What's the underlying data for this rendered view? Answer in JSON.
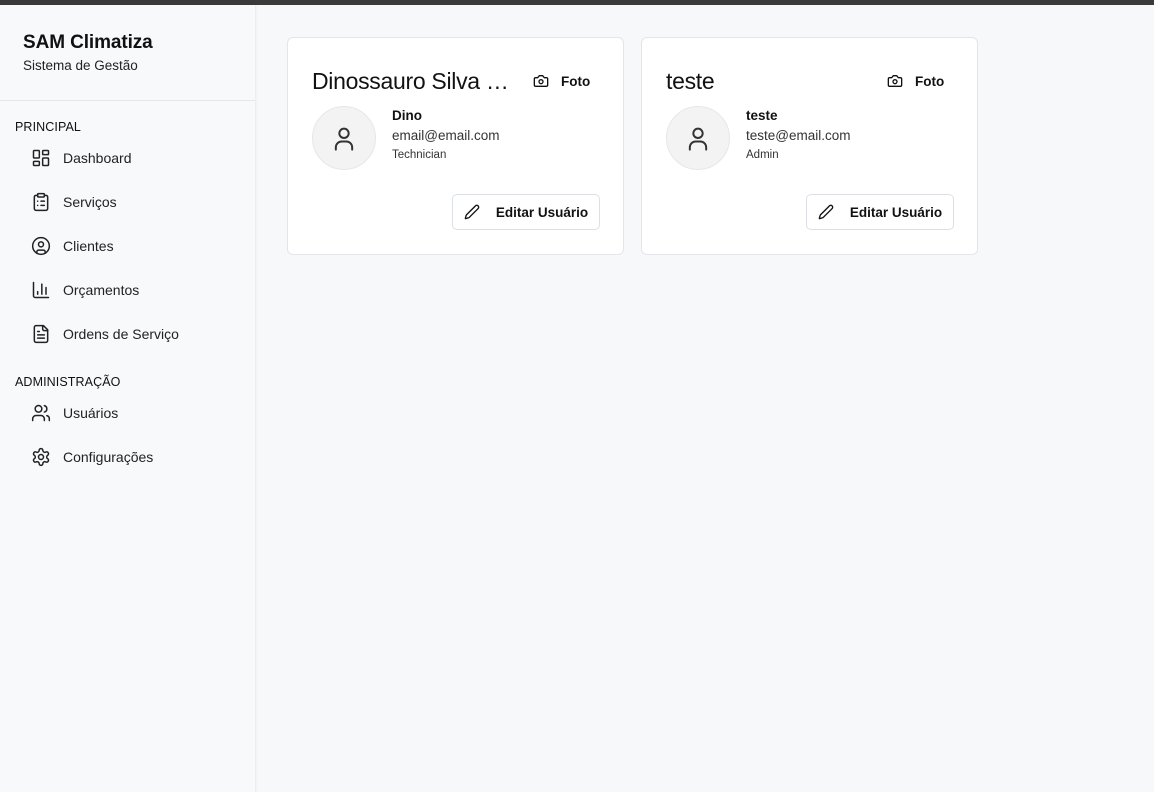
{
  "brand": {
    "title": "SAM Climatiza",
    "subtitle": "Sistema de Gestão"
  },
  "sidebar": {
    "sections": [
      {
        "label": "PRINCIPAL",
        "items": [
          {
            "label": "Dashboard",
            "icon": "layout-dashboard-icon"
          },
          {
            "label": "Serviços",
            "icon": "clipboard-list-icon"
          },
          {
            "label": "Clientes",
            "icon": "user-circle-icon"
          },
          {
            "label": "Orçamentos",
            "icon": "bar-chart-icon"
          },
          {
            "label": "Ordens de Serviço",
            "icon": "file-text-icon"
          }
        ]
      },
      {
        "label": "ADMINISTRAÇÃO",
        "items": [
          {
            "label": "Usuários",
            "icon": "users-icon"
          },
          {
            "label": "Configurações",
            "icon": "settings-icon"
          }
        ]
      }
    ]
  },
  "users": [
    {
      "title": "Dinossauro Silva Santos",
      "name": "Dino",
      "email": "email@email.com",
      "role": "Technician",
      "photo_label": "Foto",
      "edit_label": "Editar Usuário"
    },
    {
      "title": "teste",
      "name": "teste",
      "email": "teste@email.com",
      "role": "Admin",
      "photo_label": "Foto",
      "edit_label": "Editar Usuário"
    }
  ],
  "colors": {
    "topbar": "#3a3a3a",
    "background": "#f7f8fa",
    "card": "#ffffff",
    "text": "#111111"
  }
}
